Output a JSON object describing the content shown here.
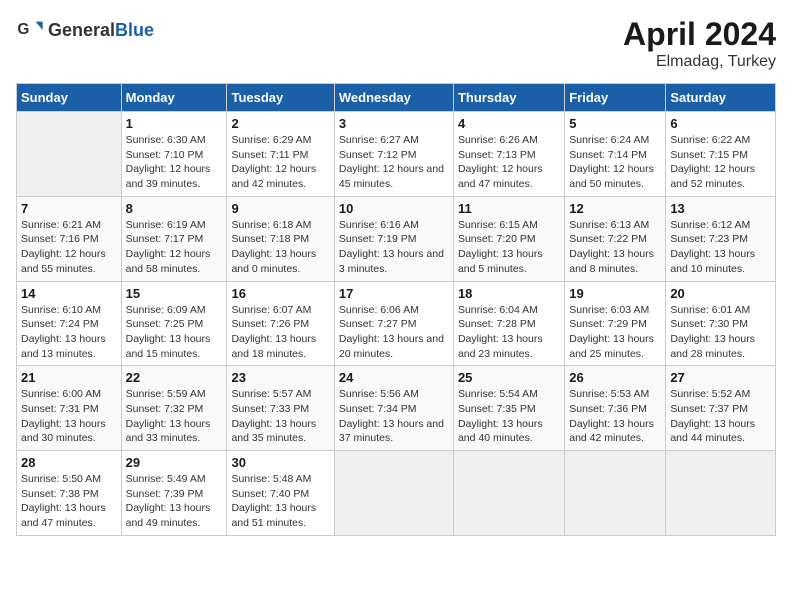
{
  "header": {
    "logo_general": "General",
    "logo_blue": "Blue",
    "main_title": "April 2024",
    "subtitle": "Elmadag, Turkey"
  },
  "days_of_week": [
    "Sunday",
    "Monday",
    "Tuesday",
    "Wednesday",
    "Thursday",
    "Friday",
    "Saturday"
  ],
  "weeks": [
    [
      {
        "num": "",
        "sunrise": "",
        "sunset": "",
        "daylight": "",
        "empty": true
      },
      {
        "num": "1",
        "sunrise": "6:30 AM",
        "sunset": "7:10 PM",
        "daylight": "12 hours and 39 minutes."
      },
      {
        "num": "2",
        "sunrise": "6:29 AM",
        "sunset": "7:11 PM",
        "daylight": "12 hours and 42 minutes."
      },
      {
        "num": "3",
        "sunrise": "6:27 AM",
        "sunset": "7:12 PM",
        "daylight": "12 hours and 45 minutes."
      },
      {
        "num": "4",
        "sunrise": "6:26 AM",
        "sunset": "7:13 PM",
        "daylight": "12 hours and 47 minutes."
      },
      {
        "num": "5",
        "sunrise": "6:24 AM",
        "sunset": "7:14 PM",
        "daylight": "12 hours and 50 minutes."
      },
      {
        "num": "6",
        "sunrise": "6:22 AM",
        "sunset": "7:15 PM",
        "daylight": "12 hours and 52 minutes."
      }
    ],
    [
      {
        "num": "7",
        "sunrise": "6:21 AM",
        "sunset": "7:16 PM",
        "daylight": "12 hours and 55 minutes."
      },
      {
        "num": "8",
        "sunrise": "6:19 AM",
        "sunset": "7:17 PM",
        "daylight": "12 hours and 58 minutes."
      },
      {
        "num": "9",
        "sunrise": "6:18 AM",
        "sunset": "7:18 PM",
        "daylight": "13 hours and 0 minutes."
      },
      {
        "num": "10",
        "sunrise": "6:16 AM",
        "sunset": "7:19 PM",
        "daylight": "13 hours and 3 minutes."
      },
      {
        "num": "11",
        "sunrise": "6:15 AM",
        "sunset": "7:20 PM",
        "daylight": "13 hours and 5 minutes."
      },
      {
        "num": "12",
        "sunrise": "6:13 AM",
        "sunset": "7:22 PM",
        "daylight": "13 hours and 8 minutes."
      },
      {
        "num": "13",
        "sunrise": "6:12 AM",
        "sunset": "7:23 PM",
        "daylight": "13 hours and 10 minutes."
      }
    ],
    [
      {
        "num": "14",
        "sunrise": "6:10 AM",
        "sunset": "7:24 PM",
        "daylight": "13 hours and 13 minutes."
      },
      {
        "num": "15",
        "sunrise": "6:09 AM",
        "sunset": "7:25 PM",
        "daylight": "13 hours and 15 minutes."
      },
      {
        "num": "16",
        "sunrise": "6:07 AM",
        "sunset": "7:26 PM",
        "daylight": "13 hours and 18 minutes."
      },
      {
        "num": "17",
        "sunrise": "6:06 AM",
        "sunset": "7:27 PM",
        "daylight": "13 hours and 20 minutes."
      },
      {
        "num": "18",
        "sunrise": "6:04 AM",
        "sunset": "7:28 PM",
        "daylight": "13 hours and 23 minutes."
      },
      {
        "num": "19",
        "sunrise": "6:03 AM",
        "sunset": "7:29 PM",
        "daylight": "13 hours and 25 minutes."
      },
      {
        "num": "20",
        "sunrise": "6:01 AM",
        "sunset": "7:30 PM",
        "daylight": "13 hours and 28 minutes."
      }
    ],
    [
      {
        "num": "21",
        "sunrise": "6:00 AM",
        "sunset": "7:31 PM",
        "daylight": "13 hours and 30 minutes."
      },
      {
        "num": "22",
        "sunrise": "5:59 AM",
        "sunset": "7:32 PM",
        "daylight": "13 hours and 33 minutes."
      },
      {
        "num": "23",
        "sunrise": "5:57 AM",
        "sunset": "7:33 PM",
        "daylight": "13 hours and 35 minutes."
      },
      {
        "num": "24",
        "sunrise": "5:56 AM",
        "sunset": "7:34 PM",
        "daylight": "13 hours and 37 minutes."
      },
      {
        "num": "25",
        "sunrise": "5:54 AM",
        "sunset": "7:35 PM",
        "daylight": "13 hours and 40 minutes."
      },
      {
        "num": "26",
        "sunrise": "5:53 AM",
        "sunset": "7:36 PM",
        "daylight": "13 hours and 42 minutes."
      },
      {
        "num": "27",
        "sunrise": "5:52 AM",
        "sunset": "7:37 PM",
        "daylight": "13 hours and 44 minutes."
      }
    ],
    [
      {
        "num": "28",
        "sunrise": "5:50 AM",
        "sunset": "7:38 PM",
        "daylight": "13 hours and 47 minutes."
      },
      {
        "num": "29",
        "sunrise": "5:49 AM",
        "sunset": "7:39 PM",
        "daylight": "13 hours and 49 minutes."
      },
      {
        "num": "30",
        "sunrise": "5:48 AM",
        "sunset": "7:40 PM",
        "daylight": "13 hours and 51 minutes."
      },
      {
        "num": "",
        "sunrise": "",
        "sunset": "",
        "daylight": "",
        "empty": true
      },
      {
        "num": "",
        "sunrise": "",
        "sunset": "",
        "daylight": "",
        "empty": true
      },
      {
        "num": "",
        "sunrise": "",
        "sunset": "",
        "daylight": "",
        "empty": true
      },
      {
        "num": "",
        "sunrise": "",
        "sunset": "",
        "daylight": "",
        "empty": true
      }
    ]
  ],
  "labels": {
    "sunrise": "Sunrise:",
    "sunset": "Sunset:",
    "daylight": "Daylight:"
  }
}
